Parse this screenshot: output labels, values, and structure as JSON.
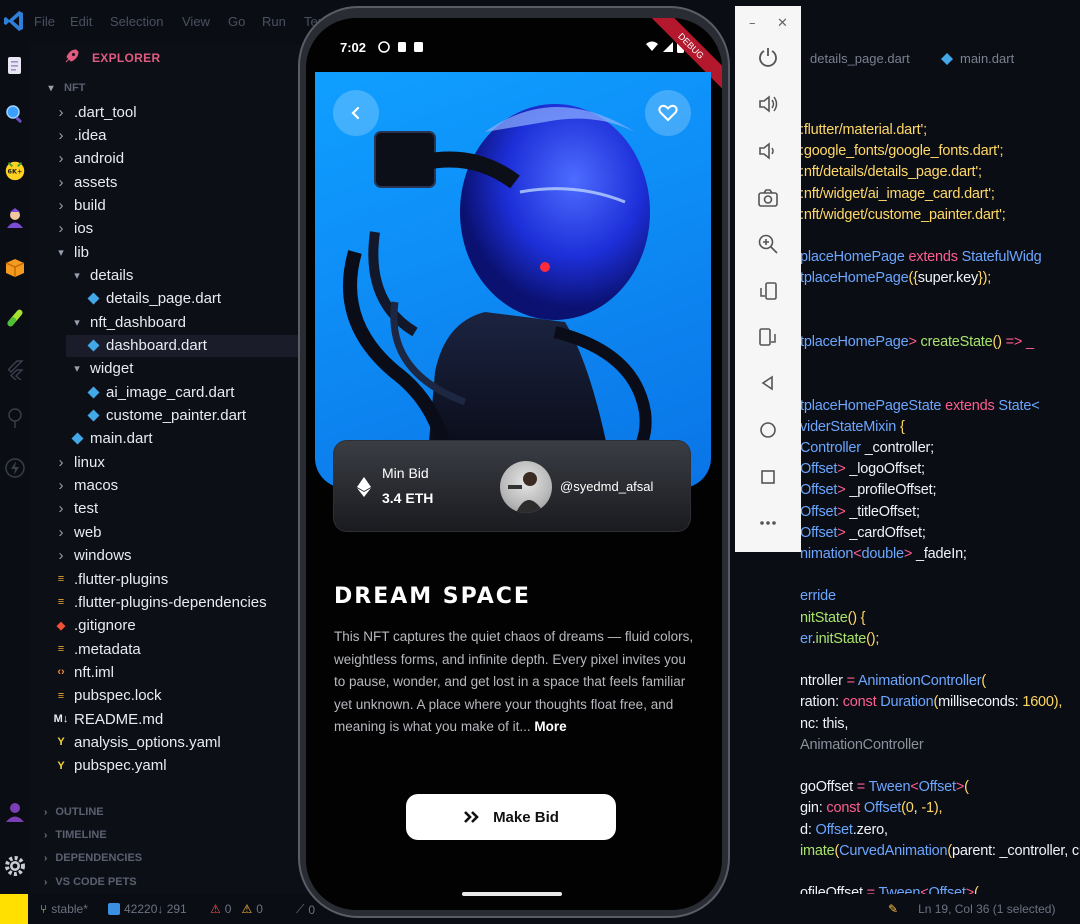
{
  "menu": [
    "File",
    "Edit",
    "Selection",
    "View",
    "Go",
    "Run",
    "Terminal"
  ],
  "explorer": {
    "title": "EXPLORER",
    "root": "NFT",
    "tree": [
      {
        "label": ".dart_tool",
        "depth": 1,
        "kind": "folder-closed"
      },
      {
        "label": ".idea",
        "depth": 1,
        "kind": "folder-closed"
      },
      {
        "label": "android",
        "depth": 1,
        "kind": "folder-closed"
      },
      {
        "label": "assets",
        "depth": 1,
        "kind": "folder-closed"
      },
      {
        "label": "build",
        "depth": 1,
        "kind": "folder-closed"
      },
      {
        "label": "ios",
        "depth": 1,
        "kind": "folder-closed"
      },
      {
        "label": "lib",
        "depth": 1,
        "kind": "folder-open"
      },
      {
        "label": "details",
        "depth": 2,
        "kind": "folder-open"
      },
      {
        "label": "details_page.dart",
        "depth": 3,
        "kind": "dart"
      },
      {
        "label": "nft_dashboard",
        "depth": 2,
        "kind": "folder-open"
      },
      {
        "label": "dashboard.dart",
        "depth": 3,
        "kind": "dart",
        "selected": true
      },
      {
        "label": "widget",
        "depth": 2,
        "kind": "folder-open"
      },
      {
        "label": "ai_image_card.dart",
        "depth": 3,
        "kind": "dart"
      },
      {
        "label": "custome_painter.dart",
        "depth": 3,
        "kind": "dart"
      },
      {
        "label": "main.dart",
        "depth": 2,
        "kind": "dart"
      },
      {
        "label": "linux",
        "depth": 1,
        "kind": "folder-closed"
      },
      {
        "label": "macos",
        "depth": 1,
        "kind": "folder-closed"
      },
      {
        "label": "test",
        "depth": 1,
        "kind": "folder-closed"
      },
      {
        "label": "web",
        "depth": 1,
        "kind": "folder-closed"
      },
      {
        "label": "windows",
        "depth": 1,
        "kind": "folder-closed"
      },
      {
        "label": ".flutter-plugins",
        "depth": 1,
        "kind": "config"
      },
      {
        "label": ".flutter-plugins-dependencies",
        "depth": 1,
        "kind": "config"
      },
      {
        "label": ".gitignore",
        "depth": 1,
        "kind": "git"
      },
      {
        "label": ".metadata",
        "depth": 1,
        "kind": "config"
      },
      {
        "label": "nft.iml",
        "depth": 1,
        "kind": "iml"
      },
      {
        "label": "pubspec.lock",
        "depth": 1,
        "kind": "config"
      },
      {
        "label": "README.md",
        "depth": 1,
        "kind": "md"
      },
      {
        "label": "analysis_options.yaml",
        "depth": 1,
        "kind": "yaml"
      },
      {
        "label": "pubspec.yaml",
        "depth": 1,
        "kind": "yaml"
      }
    ],
    "sections": [
      "OUTLINE",
      "TIMELINE",
      "DEPENDENCIES",
      "VS CODE PETS"
    ]
  },
  "editor": {
    "tabs": [
      "details_page.dart",
      "main.dart"
    ],
    "code": [
      [
        [
          "c-str",
          ":flutter/material.dart';"
        ]
      ],
      [
        [
          "c-str",
          ":google_fonts/google_fonts.dart';"
        ]
      ],
      [
        [
          "c-str",
          ":nft/details/details_page.dart';"
        ]
      ],
      [
        [
          "c-str",
          ":nft/widget/ai_image_card.dart';"
        ]
      ],
      [
        [
          "c-str",
          ":nft/widget/custome_painter.dart';"
        ]
      ],
      [],
      [
        [
          "c-type",
          "placeHomePage "
        ],
        [
          "c-kw",
          "extends "
        ],
        [
          "c-type",
          "StatefulWidg"
        ]
      ],
      [
        [
          "c-type",
          "tplaceHomePage"
        ],
        [
          "c-br",
          "({"
        ],
        [
          "c-txt",
          "super"
        ],
        [
          "c-txt",
          ".key"
        ],
        [
          "c-br",
          "});"
        ]
      ],
      [],
      [],
      [
        [
          "c-type",
          "tplaceHomePage"
        ],
        [
          "c-kw",
          "> "
        ],
        [
          "c-fn",
          "createState"
        ],
        [
          "c-br",
          "() "
        ],
        [
          "c-kw",
          "=> _"
        ]
      ],
      [],
      [],
      [
        [
          "c-type",
          "tplaceHomePageState "
        ],
        [
          "c-kw",
          "extends "
        ],
        [
          "c-type",
          "State<"
        ]
      ],
      [
        [
          "c-type",
          "viderStateMixin "
        ],
        [
          "c-br",
          "{"
        ]
      ],
      [
        [
          "c-type",
          "Controller "
        ],
        [
          "c-txt",
          "_controller;"
        ]
      ],
      [
        [
          "c-type",
          "Offset"
        ],
        [
          "c-kw",
          "> "
        ],
        [
          "c-txt",
          "_logoOffset;"
        ]
      ],
      [
        [
          "c-type",
          "Offset"
        ],
        [
          "c-kw",
          "> "
        ],
        [
          "c-txt",
          "_profileOffset;"
        ]
      ],
      [
        [
          "c-type",
          "Offset"
        ],
        [
          "c-kw",
          "> "
        ],
        [
          "c-txt",
          "_titleOffset;"
        ]
      ],
      [
        [
          "c-type",
          "Offset"
        ],
        [
          "c-kw",
          "> "
        ],
        [
          "c-txt",
          "_cardOffset;"
        ]
      ],
      [
        [
          "c-type",
          "nimation"
        ],
        [
          "c-kw",
          "<"
        ],
        [
          "c-type",
          "double"
        ],
        [
          "c-kw",
          "> "
        ],
        [
          "c-txt",
          "_fadeIn;"
        ]
      ],
      [],
      [
        [
          "c-type",
          "erride"
        ]
      ],
      [
        [
          "c-fn",
          "nitState"
        ],
        [
          "c-br",
          "() {"
        ]
      ],
      [
        [
          "c-type",
          "er"
        ],
        [
          "c-txt",
          "."
        ],
        [
          "c-fn",
          "initState"
        ],
        [
          "c-br",
          "();"
        ]
      ],
      [],
      [
        [
          "c-txt",
          "ntroller "
        ],
        [
          "c-kw",
          "= "
        ],
        [
          "c-type",
          "AnimationController"
        ],
        [
          "c-br",
          "("
        ]
      ],
      [
        [
          "c-txt",
          "ration: "
        ],
        [
          "c-kw",
          "const "
        ],
        [
          "c-type",
          "Duration"
        ],
        [
          "c-br",
          "("
        ],
        [
          "c-txt",
          "milliseconds: "
        ],
        [
          "c-num",
          "1600"
        ],
        [
          "c-br",
          "),"
        ]
      ],
      [
        [
          "c-txt",
          "nc: this,"
        ]
      ],
      [
        [
          "c-dim",
          " AnimationController"
        ]
      ],
      [],
      [
        [
          "c-txt",
          "goOffset "
        ],
        [
          "c-kw",
          "= "
        ],
        [
          "c-type",
          "Tween"
        ],
        [
          "c-kw",
          "<"
        ],
        [
          "c-type",
          "Offset"
        ],
        [
          "c-kw",
          ">"
        ],
        [
          "c-br",
          "("
        ]
      ],
      [
        [
          "c-txt",
          "gin: "
        ],
        [
          "c-kw",
          "const "
        ],
        [
          "c-type",
          "Offset"
        ],
        [
          "c-br",
          "("
        ],
        [
          "c-num",
          "0"
        ],
        [
          "c-txt",
          ", "
        ],
        [
          "c-num",
          "-1"
        ],
        [
          "c-br",
          "),"
        ]
      ],
      [
        [
          "c-txt",
          "d: "
        ],
        [
          "c-type",
          "Offset"
        ],
        [
          "c-txt",
          ".zero,"
        ]
      ],
      [
        [
          "c-fn",
          "imate"
        ],
        [
          "c-br",
          "("
        ],
        [
          "c-type",
          "CurvedAnimation"
        ],
        [
          "c-br",
          "("
        ],
        [
          "c-txt",
          "parent: _controller, cur"
        ]
      ],
      [],
      [
        [
          "c-txt",
          "ofileOffset "
        ],
        [
          "c-kw",
          "= "
        ],
        [
          "c-type",
          "Tween"
        ],
        [
          "c-kw",
          "<"
        ],
        [
          "c-type",
          "Offset"
        ],
        [
          "c-kw",
          ">"
        ],
        [
          "c-br",
          "("
        ]
      ]
    ]
  },
  "statusbar": {
    "branch": "stable*",
    "sync": "42220↓ 291",
    "errors": "0",
    "warnings": "0",
    "ports": "0",
    "position": "Ln 19, Col 36 (1 selected)"
  },
  "phone": {
    "time": "7:02",
    "debug": "DEBUG",
    "min_bid_label": "Min Bid",
    "min_bid_value": "3.4 ETH",
    "owner_handle": "@syedmd_afsal",
    "title": "DREAM SPACE",
    "description": "This NFT captures the quiet chaos of dreams — fluid colors, weightless forms, and infinite depth. Every pixel invites you to pause, wonder, and get lost in a space that feels familiar yet unknown. A place where your thoughts float free, and meaning is what you make of it...",
    "more": "More",
    "button": "Make Bid"
  },
  "colors": {
    "accent": "#e05b7f",
    "hero_blue": "#0e8ef7",
    "code_string": "#ffd866",
    "code_keyword": "#ff5d8f",
    "code_type": "#6ba6ff"
  }
}
